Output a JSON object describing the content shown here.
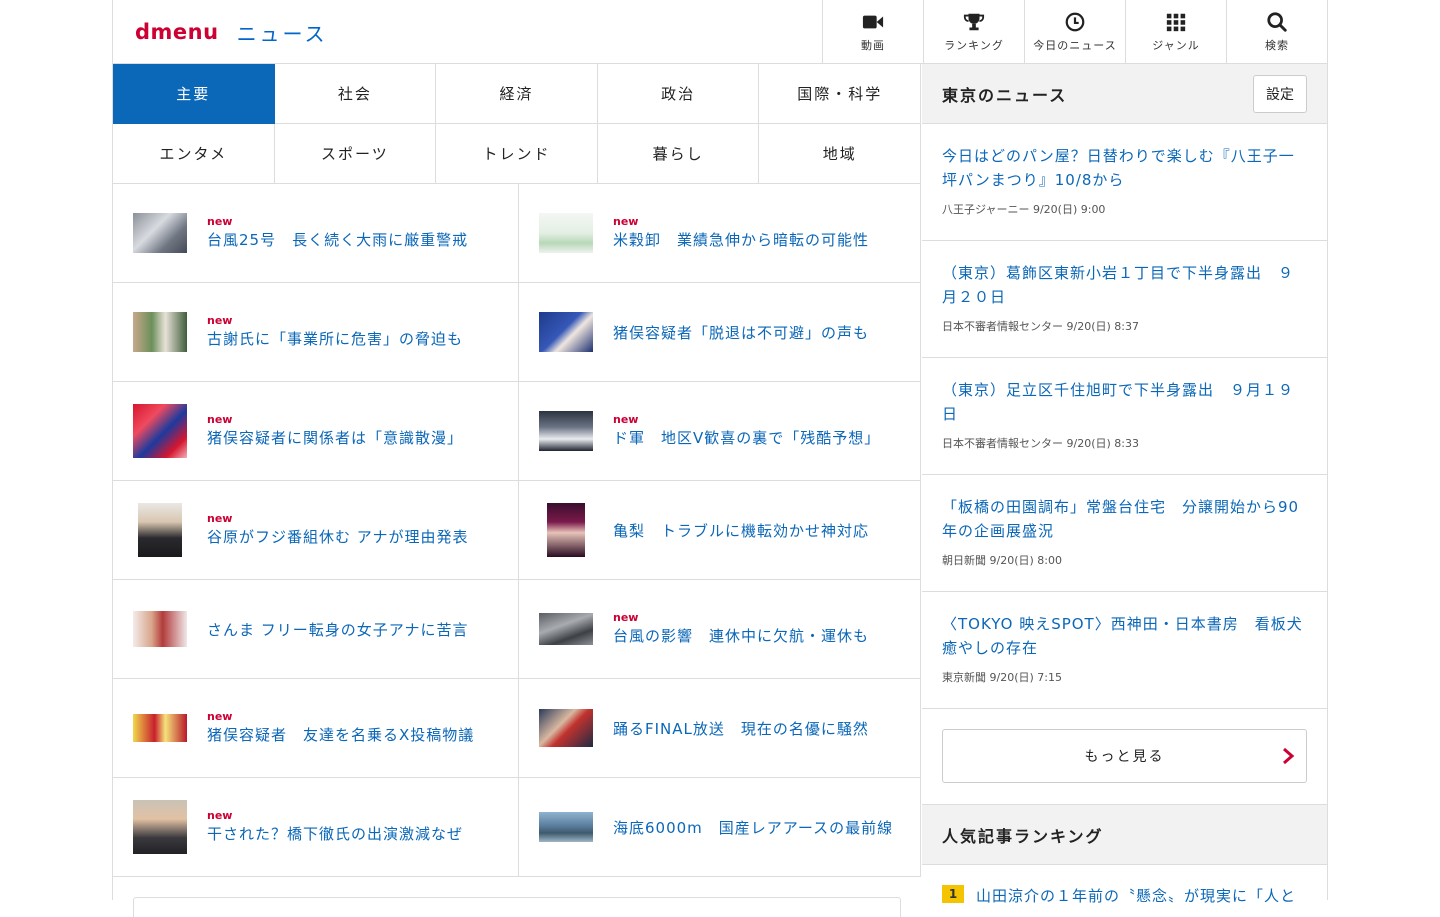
{
  "header": {
    "logo_d": "dmenu",
    "logo_news": "ニュース",
    "nav": [
      {
        "label": "動画",
        "icon": "video-icon"
      },
      {
        "label": "ランキング",
        "icon": "trophy-icon"
      },
      {
        "label": "今日のニュース",
        "icon": "clock-icon"
      },
      {
        "label": "ジャンル",
        "icon": "grid-icon"
      },
      {
        "label": "検索",
        "icon": "search-icon"
      }
    ]
  },
  "categories": [
    "主要",
    "社会",
    "経済",
    "政治",
    "国際・科学",
    "エンタメ",
    "スポーツ",
    "トレンド",
    "暮らし",
    "地域"
  ],
  "articles": [
    {
      "new": "new",
      "title": "台風25号　長く続く大雨に厳重警戒"
    },
    {
      "new": "new",
      "title": "米穀卸　業績急伸から暗転の可能性"
    },
    {
      "new": "new",
      "title": "古謝氏に「事業所に危害」の脅迫も"
    },
    {
      "new": "",
      "title": "猪俣容疑者「脱退は不可避」の声も"
    },
    {
      "new": "new",
      "title": "猪俣容疑者に関係者は「意識散漫」"
    },
    {
      "new": "new",
      "title": "ド軍　地区V歓喜の裏で「残酷予想」"
    },
    {
      "new": "new",
      "title": "谷原がフジ番組休む アナが理由発表"
    },
    {
      "new": "",
      "title": "亀梨　トラブルに機転効かせ神対応"
    },
    {
      "new": "",
      "title": "さんま フリー転身の女子アナに苦言"
    },
    {
      "new": "new",
      "title": "台風の影響　連休中に欠航・運休も"
    },
    {
      "new": "new",
      "title": "猪俣容疑者　友達を名乗るX投稿物議"
    },
    {
      "new": "",
      "title": "踊るFINAL放送　現在の名優に騒然"
    },
    {
      "new": "new",
      "title": "干された？橋下徹氏の出演激減なぜ"
    },
    {
      "new": "",
      "title": "海底6000m　国産レアアースの最前線"
    }
  ],
  "local": {
    "title": "東京のニュース",
    "setting": "設定",
    "items": [
      {
        "title": "今日はどのパン屋？日替わりで楽しむ『八王子一坪パンまつり』10/8から",
        "source": "八王子ジャーニー",
        "time": "9/20(日) 9:00"
      },
      {
        "title": "（東京）葛飾区東新小岩１丁目で下半身露出　９月２０日",
        "source": "日本不審者情報センター",
        "time": "9/20(日) 8:37"
      },
      {
        "title": "（東京）足立区千住旭町で下半身露出　９月１９日",
        "source": "日本不審者情報センター",
        "time": "9/20(日) 8:33"
      },
      {
        "title": "「板橋の田園調布」常盤台住宅　分譲開始から90年の企画展盛況",
        "source": "朝日新聞",
        "time": "9/20(日) 8:00"
      },
      {
        "title": "〈TOKYO 映えSPOT〉西神田・日本書房　看板犬癒やしの存在",
        "source": "東京新聞",
        "time": "9/20(日) 7:15"
      }
    ],
    "more": "もっと見る"
  },
  "ranking": {
    "title": "人気記事ランキング",
    "items": [
      {
        "rank": "1",
        "title": "山田涼介の１年前の〝懸念〟が現実に「人と"
      }
    ]
  },
  "colors": {
    "accent": "#0b67b8",
    "logo_red": "#cc0033",
    "badge_new": "#cc0033",
    "rank_badge": "#f5c400"
  }
}
